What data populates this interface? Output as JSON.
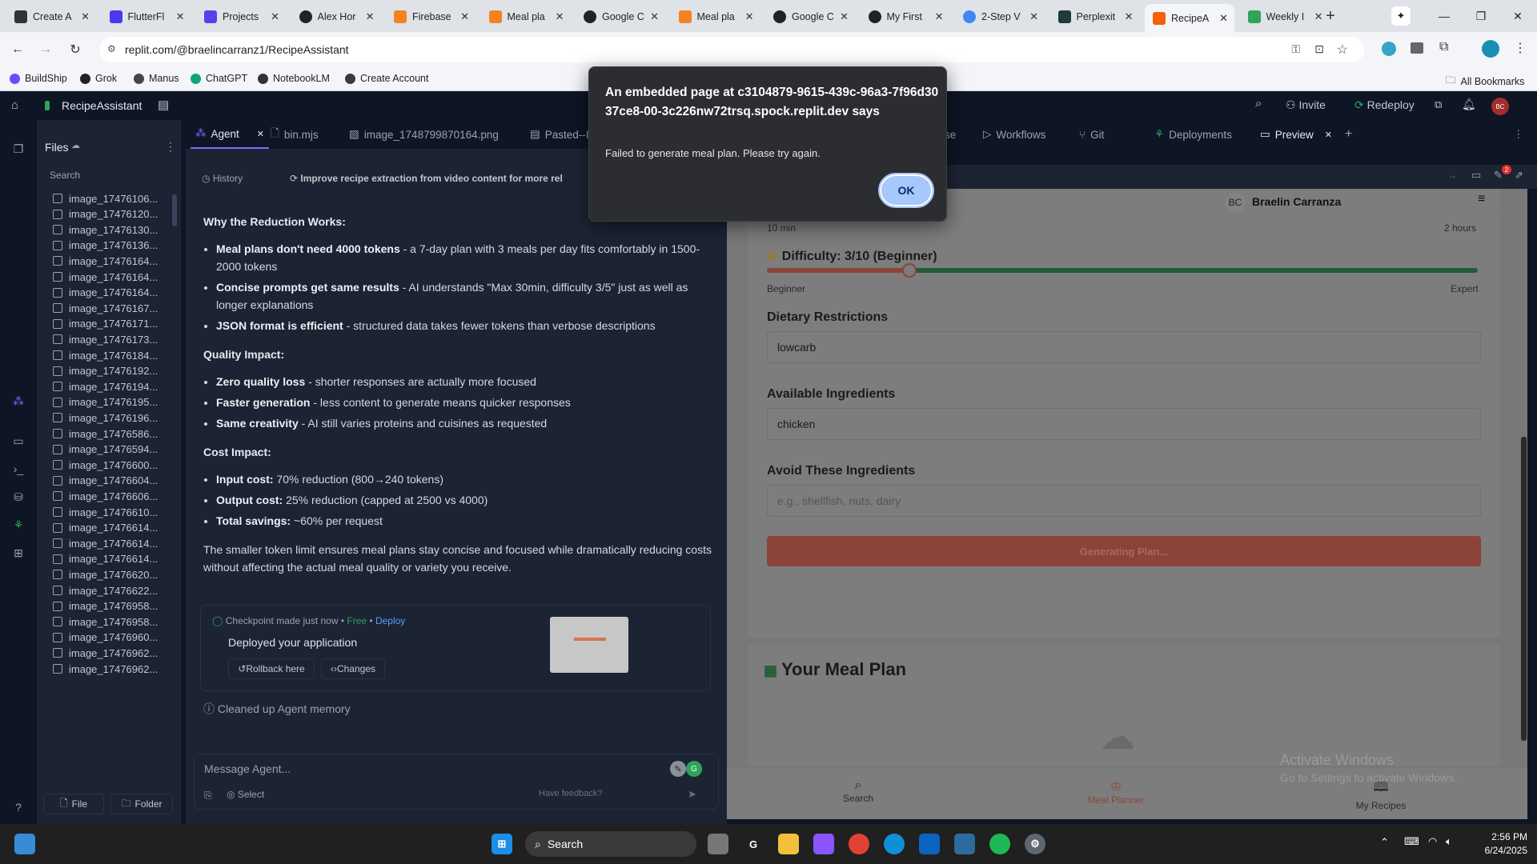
{
  "browser": {
    "tabs": [
      {
        "title": "Create A",
        "icon": "sw"
      },
      {
        "title": "FlutterFl",
        "icon": "flutterflow"
      },
      {
        "title": "Projects",
        "icon": "figma"
      },
      {
        "title": "Alex Hor",
        "icon": "github"
      },
      {
        "title": "Firebase",
        "icon": "firebase"
      },
      {
        "title": "Meal pla",
        "icon": "firebase"
      },
      {
        "title": "Google C",
        "icon": "github"
      },
      {
        "title": "Meal pla",
        "icon": "firebase"
      },
      {
        "title": "Google C",
        "icon": "github"
      },
      {
        "title": "My First",
        "icon": "github"
      },
      {
        "title": "2-Step V",
        "icon": "google"
      },
      {
        "title": "Perplexit",
        "icon": "perplexity"
      },
      {
        "title": "RecipeA",
        "icon": "replit"
      },
      {
        "title": "Weekly I",
        "icon": "leaf"
      }
    ],
    "url": "replit.com/@braelincarranz1/RecipeAssistant",
    "bookmarks": [
      {
        "label": "BuildShip"
      },
      {
        "label": "Grok"
      },
      {
        "label": "Manus"
      },
      {
        "label": "ChatGPT"
      },
      {
        "label": "NotebookLM"
      },
      {
        "label": "Create Account"
      }
    ],
    "all_bookmarks": "All Bookmarks"
  },
  "replit": {
    "project_name": "RecipeAssistant",
    "invite": "Invite",
    "redeploy": "Redeploy",
    "avatar": "BC",
    "files_title": "Files",
    "search_placeholder": "Search",
    "files": [
      "image_17476106...",
      "image_17476120...",
      "image_17476130...",
      "image_17476136...",
      "image_17476164...",
      "image_17476164...",
      "image_17476164...",
      "image_17476167...",
      "image_17476171...",
      "image_17476173...",
      "image_17476184...",
      "image_17476192...",
      "image_17476194...",
      "image_17476195...",
      "image_17476196...",
      "image_17476586...",
      "image_17476594...",
      "image_17476600...",
      "image_17476604...",
      "image_17476606...",
      "image_17476610...",
      "image_17476614...",
      "image_17476614...",
      "image_17476614...",
      "image_17476620...",
      "image_17476622...",
      "image_17476958...",
      "image_17476958...",
      "image_17476960...",
      "image_17476962...",
      "image_17476962..."
    ],
    "file_button": "File",
    "folder_button": "Folder",
    "pane_tabs": [
      "Agent",
      "bin.mjs",
      "image_1748799870164.png",
      "Pasted--I",
      "se",
      "Workflows",
      "Git",
      "Deployments",
      "Preview"
    ],
    "history": "History",
    "history_title": "Improve recipe extraction from video content for more reliable r",
    "agent": {
      "heading1": "Why the Reduction Works:",
      "list1": [
        {
          "b": "Meal plans don't need 4000 tokens",
          "t": " - a 7-day plan with 3 meals per day fits comfortably in 1500-2000 tokens"
        },
        {
          "b": "Concise prompts get same results",
          "t": " - AI understands \"Max 30min, difficulty 3/5\" just as well as longer explanations"
        },
        {
          "b": "JSON format is efficient",
          "t": " - structured data takes fewer tokens than verbose descriptions"
        }
      ],
      "heading2": "Quality Impact:",
      "list2": [
        {
          "b": "Zero quality loss",
          "t": " - shorter responses are actually more focused"
        },
        {
          "b": "Faster generation",
          "t": " - less content to generate means quicker responses"
        },
        {
          "b": "Same creativity",
          "t": " - AI still varies proteins and cuisines as requested"
        }
      ],
      "heading3": "Cost Impact:",
      "list3": [
        {
          "b": "Input cost:",
          "t": " 70% reduction (800→240 tokens)"
        },
        {
          "b": "Output cost:",
          "t": " 25% reduction (capped at 2500 vs 4000)"
        },
        {
          "b": "Total savings:",
          "t": " ~60% per request"
        }
      ],
      "summary": "The smaller token limit ensures meal plans stay concise and focused while dramatically reducing costs without affecting the actual meal quality or variety you receive.",
      "checkpoint": "Checkpoint made just now",
      "free": "Free",
      "deploy": "Deploy",
      "deployed": "Deployed your application",
      "rollback": "Rollback here",
      "changes": "Changes",
      "memory": "Cleaned up Agent memory",
      "message_placeholder": "Message Agent...",
      "select": "Select",
      "feedback": "Have feedback?"
    }
  },
  "app": {
    "user_initials": "BC",
    "user_name": "Braelin Carranza",
    "time_left": "10 min",
    "time_right": "2 hours",
    "difficulty_label": "Difficulty: 3/10 (Beginner)",
    "difficulty_value": 3,
    "difficulty_max": 10,
    "beginner": "Beginner",
    "expert": "Expert",
    "dietary_label": "Dietary Restrictions",
    "dietary_value": "lowcarb",
    "ingredients_label": "Available Ingredients",
    "ingredients_value": "chicken",
    "avoid_label": "Avoid These Ingredients",
    "avoid_placeholder": "e.g., shellfish, nuts, dairy",
    "generating": "Generating Plan...",
    "meal_plan_title": "Your Meal Plan",
    "nav": [
      {
        "label": "Search",
        "icon": "search-icon"
      },
      {
        "label": "Meal Planner",
        "icon": "chef-hat-icon"
      },
      {
        "label": "My Recipes",
        "icon": "book-icon"
      }
    ],
    "accent": "#e2725b"
  },
  "dialog": {
    "title": "An embedded page at c3104879-9615-439c-96a3-7f96d3037ce8-00-3c226nw72trsq.spock.replit.dev says",
    "message": "Failed to generate meal plan. Please try again.",
    "ok": "OK"
  },
  "watermark": {
    "line1": "Activate Windows",
    "line2": "Go to Settings to activate Windows."
  },
  "taskbar": {
    "search": "Search",
    "time": "2:56 PM",
    "date": "6/24/2025"
  }
}
